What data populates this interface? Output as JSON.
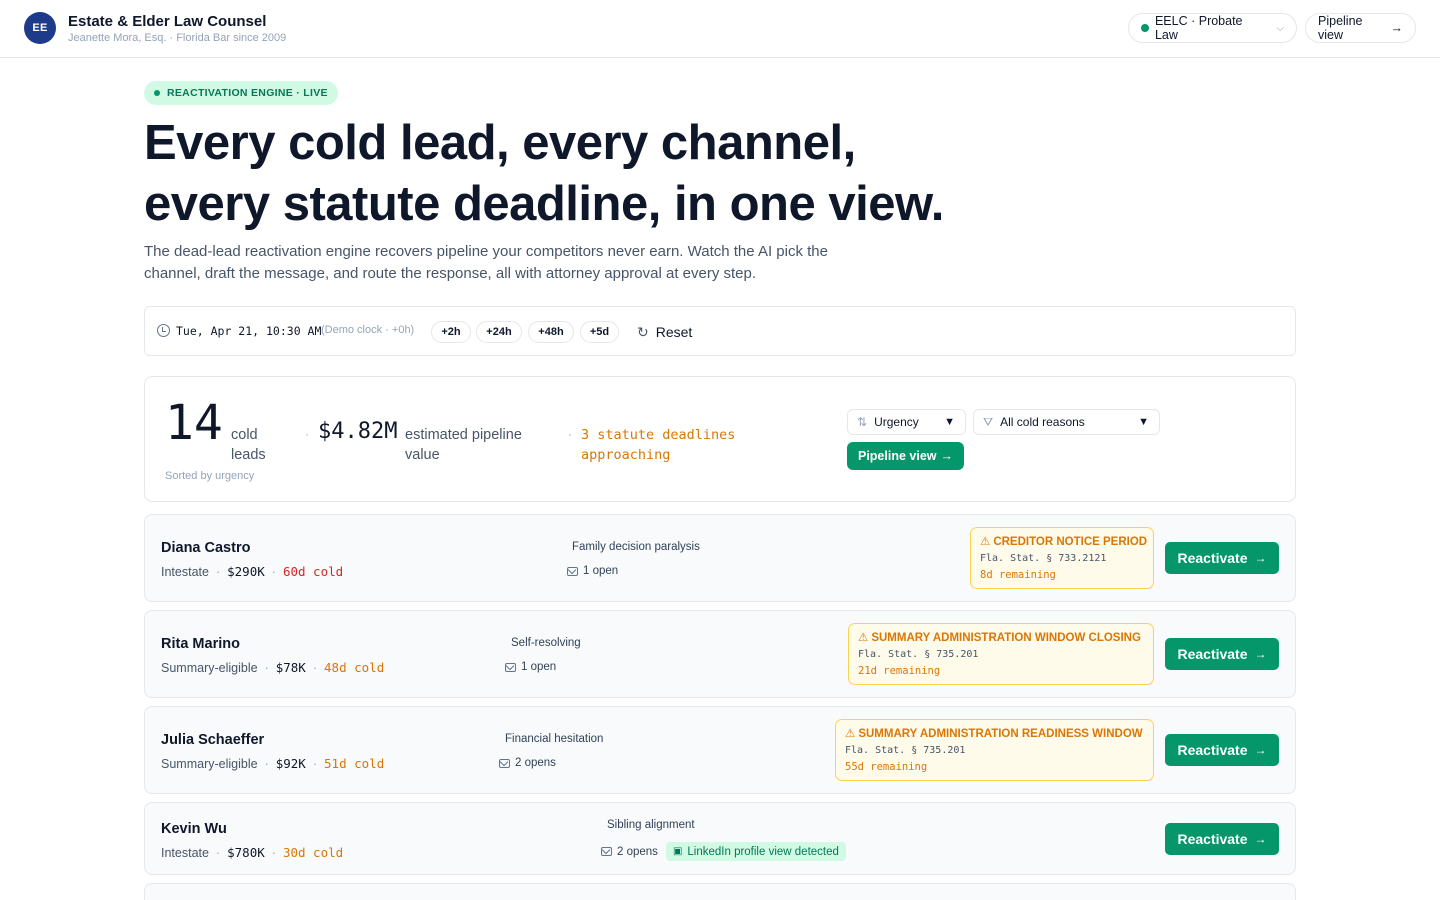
{
  "header": {
    "avatar_initials": "EE",
    "firm_name": "Estate & Elder Law Counsel",
    "firm_subtitle": "Jeanette Mora, Esq. · Florida Bar since 2009",
    "firm_selector": "EELC · Probate Law",
    "pipeline_view_label": "Pipeline view",
    "accent_color": "#059669",
    "avatar_color": "#1e3a8a"
  },
  "hero": {
    "badge": "REACTIVATION ENGINE · LIVE",
    "title_line1": "Every cold lead, every channel,",
    "title_line2": "every statute deadline, in one view.",
    "subtitle": "The dead-lead reactivation engine recovers pipeline your competitors never earn. Watch the AI pick the channel, draft the message, and route the response, all with attorney approval at every step."
  },
  "clock": {
    "time": "Tue, Apr 21, 10:30 AM",
    "demo_note": "(Demo clock · +0h)",
    "steps": [
      "+2h",
      "+24h",
      "+48h",
      "+5d"
    ],
    "reset_label": "Reset"
  },
  "summary": {
    "lead_count": "14",
    "lead_label": "cold leads",
    "sorted_note": "Sorted by urgency",
    "pipeline_value": "$4.82M",
    "pipeline_label": "estimated pipeline value",
    "statute_alert": "3 statute deadlines approaching",
    "sort_select": "Urgency",
    "reason_select": "All cold reasons",
    "pipeline_button": "Pipeline view"
  },
  "leads": [
    {
      "name": "Diana Castro",
      "type": "Intestate",
      "value": "$290K",
      "cold": "60d cold",
      "reason": "Family decision paralysis",
      "opens": "1 open",
      "deadline": {
        "title": "CREDITOR NOTICE PERIOD",
        "statute": "Fla. Stat. § 733.2121",
        "remaining": "8d remaining"
      },
      "action": "Reactivate"
    },
    {
      "name": "Rita Marino",
      "type": "Summary-eligible",
      "value": "$78K",
      "cold": "48d cold",
      "reason": "Self-resolving",
      "opens": "1 open",
      "deadline": {
        "title": "SUMMARY ADMINISTRATION WINDOW CLOSING",
        "statute": "Fla. Stat. § 735.201",
        "remaining": "21d remaining"
      },
      "action": "Reactivate"
    },
    {
      "name": "Julia Schaeffer",
      "type": "Summary-eligible",
      "value": "$92K",
      "cold": "51d cold",
      "reason": "Financial hesitation",
      "opens": "2 opens",
      "deadline": {
        "title": "SUMMARY ADMINISTRATION READINESS WINDOW",
        "statute": "Fla. Stat. § 735.201",
        "remaining": "55d remaining"
      },
      "action": "Reactivate"
    },
    {
      "name": "Kevin Wu",
      "type": "Intestate",
      "value": "$780K",
      "cold": "30d cold",
      "reason": "Sibling alignment",
      "opens": "2 opens",
      "signal": "LinkedIn profile view detected",
      "action": "Reactivate"
    }
  ]
}
